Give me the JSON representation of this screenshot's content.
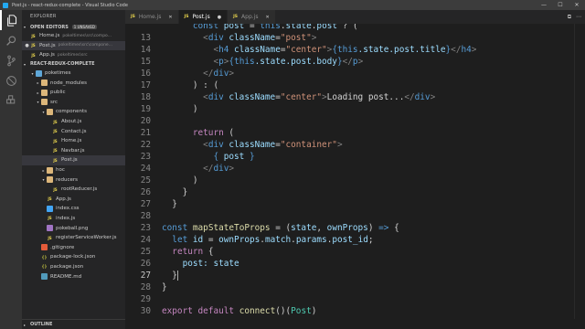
{
  "titlebar": {
    "title": "Post.js - react-redux-complete - Visual Studio Code",
    "minimize": "—",
    "maximize": "☐",
    "close": "✕"
  },
  "sidebar": {
    "header": "EXPLORER",
    "open_editors": {
      "label": "OPEN EDITORS",
      "badge": "1 UNSAVED"
    },
    "open_files": [
      {
        "name": "Home.js",
        "path": "pokeltimes\\src\\compo...",
        "selected": false,
        "dirty": false
      },
      {
        "name": "Post.js",
        "path": "pokeltimes\\src\\compone...",
        "selected": true,
        "dirty": true
      },
      {
        "name": "App.js",
        "path": "pokeltimes\\src",
        "selected": false,
        "dirty": false
      }
    ],
    "project": {
      "label": "REACT-REDUX-COMPLETE"
    },
    "tree": [
      {
        "name": "poketimes",
        "kind": "folder-blue",
        "depth": 1,
        "caret": "▾"
      },
      {
        "name": "node_modules",
        "kind": "folder",
        "depth": 2,
        "caret": "▸"
      },
      {
        "name": "public",
        "kind": "folder",
        "depth": 2,
        "caret": "▸"
      },
      {
        "name": "src",
        "kind": "folder",
        "depth": 2,
        "caret": "▾"
      },
      {
        "name": "components",
        "kind": "folder",
        "depth": 3,
        "caret": "▾"
      },
      {
        "name": "About.js",
        "kind": "js",
        "depth": 4,
        "caret": ""
      },
      {
        "name": "Contact.js",
        "kind": "js",
        "depth": 4,
        "caret": ""
      },
      {
        "name": "Home.js",
        "kind": "js",
        "depth": 4,
        "caret": ""
      },
      {
        "name": "Navbar.js",
        "kind": "js",
        "depth": 4,
        "caret": ""
      },
      {
        "name": "Post.js",
        "kind": "js",
        "depth": 4,
        "caret": "",
        "selected": true
      },
      {
        "name": "hoc",
        "kind": "folder",
        "depth": 3,
        "caret": "▸"
      },
      {
        "name": "reducers",
        "kind": "folder",
        "depth": 3,
        "caret": "▾"
      },
      {
        "name": "rootReducer.js",
        "kind": "js",
        "depth": 4,
        "caret": ""
      },
      {
        "name": "App.js",
        "kind": "js",
        "depth": 3,
        "caret": ""
      },
      {
        "name": "index.css",
        "kind": "css",
        "depth": 3,
        "caret": ""
      },
      {
        "name": "index.js",
        "kind": "js",
        "depth": 3,
        "caret": ""
      },
      {
        "name": "pokeball.png",
        "kind": "png",
        "depth": 3,
        "caret": ""
      },
      {
        "name": "registerServiceWorker.js",
        "kind": "js",
        "depth": 3,
        "caret": ""
      },
      {
        "name": ".gitignore",
        "kind": "git",
        "depth": 2,
        "caret": ""
      },
      {
        "name": "package-lock.json",
        "kind": "json",
        "depth": 2,
        "caret": ""
      },
      {
        "name": "package.json",
        "kind": "json",
        "depth": 2,
        "caret": ""
      },
      {
        "name": "README.md",
        "kind": "md",
        "depth": 2,
        "caret": ""
      }
    ],
    "outline": "OUTLINE"
  },
  "tabs": [
    {
      "name": "Home.js",
      "active": false,
      "close": "✕"
    },
    {
      "name": "Post.js",
      "active": true,
      "close": "●"
    },
    {
      "name": "App.js",
      "active": false,
      "close": "✕"
    }
  ],
  "tab_actions": [
    "⧉",
    "⋯"
  ],
  "editor": {
    "current_line": 27,
    "lines": [
      {
        "n": "",
        "tokens": [
          [
            "      ",
            "p"
          ],
          [
            "const",
            "kw"
          ],
          [
            " post ",
            "v"
          ],
          [
            "=",
            "p"
          ],
          [
            " this",
            "kw"
          ],
          [
            ".",
            "p"
          ],
          [
            "state",
            "v"
          ],
          [
            ".",
            "p"
          ],
          [
            "post",
            "v"
          ],
          [
            " ? (",
            "p"
          ]
        ]
      },
      {
        "n": "13",
        "tokens": [
          [
            "        <",
            "t"
          ],
          [
            "div",
            "tag"
          ],
          [
            " className",
            "at"
          ],
          [
            "=",
            "p"
          ],
          [
            "\"post\"",
            "s"
          ],
          [
            ">",
            "t"
          ]
        ]
      },
      {
        "n": "14",
        "tokens": [
          [
            "          <",
            "t"
          ],
          [
            "h4",
            "tag"
          ],
          [
            " className",
            "at"
          ],
          [
            "=",
            "p"
          ],
          [
            "\"center\"",
            "s"
          ],
          [
            ">",
            "t"
          ],
          [
            "{",
            "br"
          ],
          [
            "this",
            "kw"
          ],
          [
            ".state.post.",
            "v"
          ],
          [
            "title",
            "v"
          ],
          [
            "}",
            "br"
          ],
          [
            "</",
            "t"
          ],
          [
            "h4",
            "tag"
          ],
          [
            ">",
            "t"
          ]
        ]
      },
      {
        "n": "15",
        "tokens": [
          [
            "          <",
            "t"
          ],
          [
            "p",
            "tag"
          ],
          [
            ">",
            "t"
          ],
          [
            "{",
            "br"
          ],
          [
            "this",
            "kw"
          ],
          [
            ".state.post.",
            "v"
          ],
          [
            "body",
            "v"
          ],
          [
            "}",
            "br"
          ],
          [
            "</",
            "t"
          ],
          [
            "p",
            "tag"
          ],
          [
            ">",
            "t"
          ]
        ]
      },
      {
        "n": "16",
        "tokens": [
          [
            "        </",
            "t"
          ],
          [
            "div",
            "tag"
          ],
          [
            ">",
            "t"
          ]
        ]
      },
      {
        "n": "17",
        "tokens": [
          [
            "      ) : (",
            "p"
          ]
        ]
      },
      {
        "n": "18",
        "tokens": [
          [
            "        <",
            "t"
          ],
          [
            "div",
            "tag"
          ],
          [
            " className",
            "at"
          ],
          [
            "=",
            "p"
          ],
          [
            "\"center\"",
            "s"
          ],
          [
            ">",
            "t"
          ],
          [
            "Loading post...",
            "p"
          ],
          [
            "</",
            "t"
          ],
          [
            "div",
            "tag"
          ],
          [
            ">",
            "t"
          ]
        ]
      },
      {
        "n": "19",
        "tokens": [
          [
            "      )",
            "p"
          ]
        ]
      },
      {
        "n": "20",
        "tokens": [
          [
            "",
            "p"
          ]
        ]
      },
      {
        "n": "21",
        "tokens": [
          [
            "      ",
            "p"
          ],
          [
            "return",
            "ctl"
          ],
          [
            " (",
            "p"
          ]
        ]
      },
      {
        "n": "22",
        "tokens": [
          [
            "        <",
            "t"
          ],
          [
            "div",
            "tag"
          ],
          [
            " className",
            "at"
          ],
          [
            "=",
            "p"
          ],
          [
            "\"container\"",
            "s"
          ],
          [
            ">",
            "t"
          ]
        ]
      },
      {
        "n": "23",
        "tokens": [
          [
            "          ",
            "p"
          ],
          [
            "{ ",
            "br"
          ],
          [
            "post",
            "v"
          ],
          [
            " }",
            "br"
          ]
        ]
      },
      {
        "n": "24",
        "tokens": [
          [
            "        </",
            "t"
          ],
          [
            "div",
            "tag"
          ],
          [
            ">",
            "t"
          ]
        ]
      },
      {
        "n": "25",
        "tokens": [
          [
            "      )",
            "p"
          ]
        ]
      },
      {
        "n": "26",
        "tokens": [
          [
            "    }",
            "p"
          ]
        ]
      },
      {
        "n": "27",
        "tokens": [
          [
            "  }",
            "p"
          ]
        ]
      },
      {
        "n": "28",
        "tokens": [
          [
            "",
            "p"
          ]
        ]
      },
      {
        "n": "23",
        "tokens": [
          [
            "const",
            "kw"
          ],
          [
            " ",
            "p"
          ],
          [
            "mapStateToProps",
            "fn"
          ],
          [
            " = (",
            "p"
          ],
          [
            "state",
            "v"
          ],
          [
            ", ",
            "p"
          ],
          [
            "ownProps",
            "v"
          ],
          [
            ") ",
            "p"
          ],
          [
            "=>",
            "kw"
          ],
          [
            " {",
            "p"
          ]
        ]
      },
      {
        "n": "24",
        "tokens": [
          [
            "  ",
            "p"
          ],
          [
            "let",
            "kw"
          ],
          [
            " ",
            "p"
          ],
          [
            "id",
            "v"
          ],
          [
            " = ",
            "p"
          ],
          [
            "ownProps",
            "v"
          ],
          [
            ".",
            "p"
          ],
          [
            "match",
            "v"
          ],
          [
            ".",
            "p"
          ],
          [
            "params",
            "v"
          ],
          [
            ".",
            "p"
          ],
          [
            "post_id",
            "v"
          ],
          [
            ";",
            "p"
          ]
        ]
      },
      {
        "n": "25",
        "tokens": [
          [
            "  ",
            "p"
          ],
          [
            "return",
            "ctl"
          ],
          [
            " {",
            "p"
          ]
        ]
      },
      {
        "n": "26",
        "tokens": [
          [
            "    post: ",
            "v"
          ],
          [
            "state",
            "v"
          ]
        ]
      },
      {
        "n": "27",
        "tokens": [
          [
            "  }",
            "p"
          ]
        ],
        "cursor": true
      },
      {
        "n": "28",
        "tokens": [
          [
            "}",
            "p"
          ]
        ]
      },
      {
        "n": "29",
        "tokens": [
          [
            "",
            "p"
          ]
        ]
      },
      {
        "n": "30",
        "tokens": [
          [
            "export",
            "ctl"
          ],
          [
            " ",
            "p"
          ],
          [
            "default",
            "ctl"
          ],
          [
            " ",
            "p"
          ],
          [
            "connect",
            "fn"
          ],
          [
            "()(",
            "p"
          ],
          [
            "Post",
            "cls"
          ],
          [
            ")",
            "p"
          ]
        ]
      }
    ]
  },
  "colors": {
    "kw": "#569cd6",
    "ctl": "#c586c0",
    "v": "#9cdcfe",
    "s": "#ce9178",
    "tag": "#569cd6",
    "at": "#9cdcfe",
    "t": "#808080",
    "p": "#d4d4d4",
    "fn": "#dcdcaa",
    "br": "#569cd6",
    "cls": "#4ec9b0"
  }
}
